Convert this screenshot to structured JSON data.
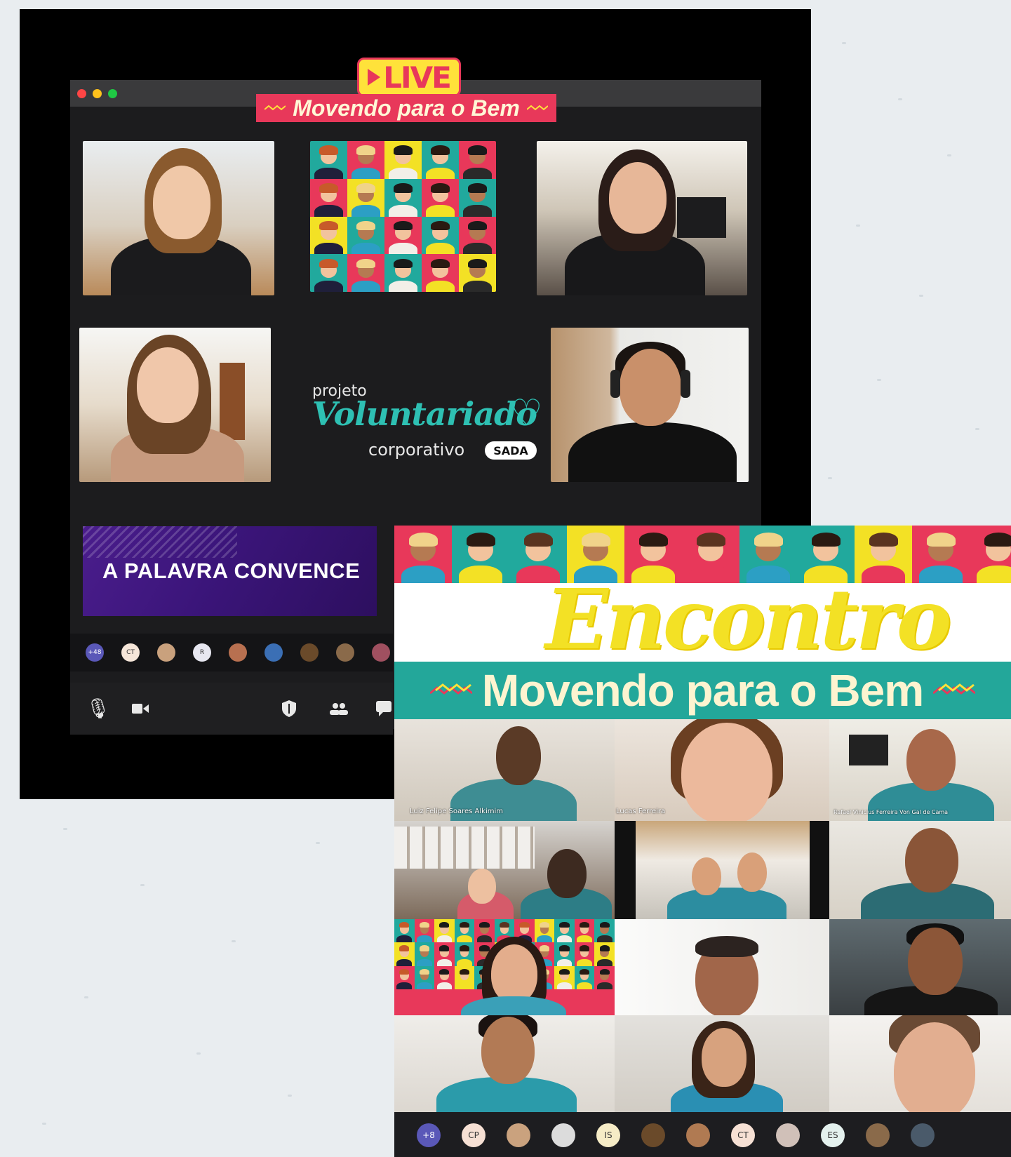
{
  "live": {
    "badge": "LIVE",
    "banner": "Movendo para o Bem",
    "projeto_line1": "projeto",
    "projeto_line2": "Voluntariado",
    "projeto_line3": "corporativo",
    "sada": "SADA",
    "palavra": "A PALAVRA CONVENCE",
    "participants": [
      "+48",
      "CT",
      "",
      "R",
      "",
      "",
      "",
      "",
      ""
    ]
  },
  "encontro": {
    "title": "Encontro",
    "subtitle": "Movendo para o Bem",
    "names": [
      "Luiz Felipe Soares Alkimim",
      "Lucas Ferreira",
      "Rafael Vinicius Ferreira Von Gal de Cama"
    ],
    "participants": [
      "+8",
      "CP",
      "",
      "",
      "IS",
      "",
      "",
      "CT",
      "",
      "ES",
      "",
      ""
    ]
  },
  "colors": {
    "accent_red": "#e8385a",
    "accent_yellow": "#ffe23a",
    "teal": "#23a79a",
    "purple": "#3b157a"
  }
}
